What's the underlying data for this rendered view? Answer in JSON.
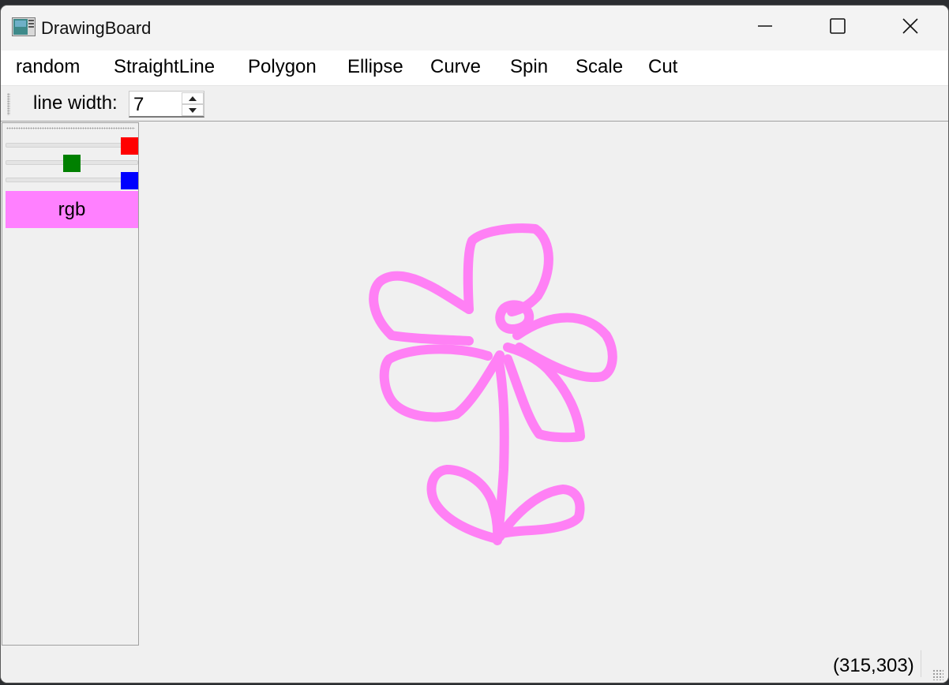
{
  "window": {
    "title": "DrawingBoard"
  },
  "menu": {
    "items": [
      "random",
      "StraightLine",
      "Polygon",
      "Ellipse",
      "Curve",
      "Spin",
      "Scale",
      "Cut"
    ]
  },
  "toolbar": {
    "line_width_label": "line width:",
    "line_width_value": "7"
  },
  "color_panel": {
    "sliders": [
      {
        "channel": "red",
        "color": "#ff0000",
        "level": 1.0
      },
      {
        "channel": "green",
        "color": "#008000",
        "level": 0.5
      },
      {
        "channel": "blue",
        "color": "#0000ff",
        "level": 1.0
      }
    ],
    "swatch_label": "rgb",
    "swatch_color": "#ff80ff"
  },
  "canvas": {
    "stroke_color": "#ff80f5"
  },
  "status": {
    "coordinates": "(315,303)"
  },
  "icons": {
    "app": "app-window-icon",
    "minimize": "minimize-icon",
    "maximize": "maximize-icon",
    "close": "close-icon"
  }
}
